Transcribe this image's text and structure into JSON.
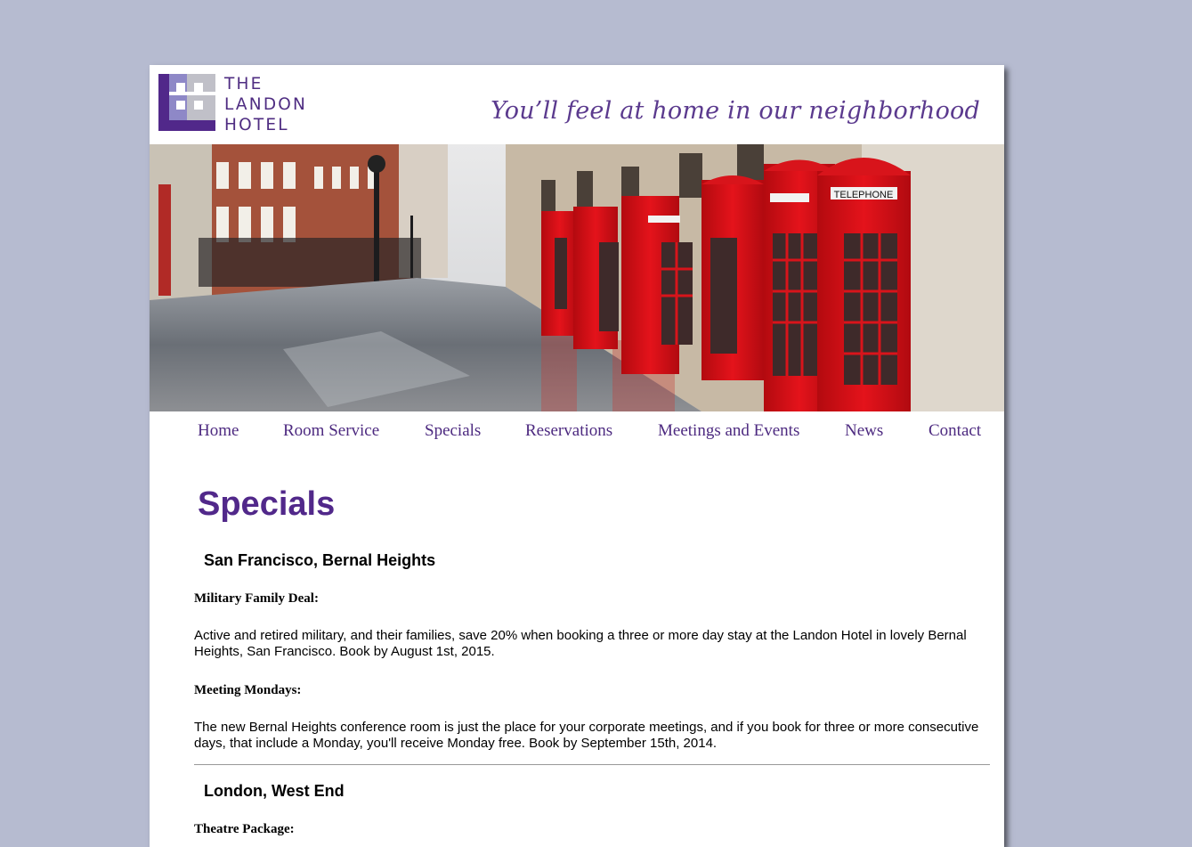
{
  "brand": {
    "logo_lines": [
      "THE",
      "LANDON",
      "HOTEL"
    ],
    "tagline": "You’ll feel at home in our neighborhood",
    "colors": {
      "brand_purple": "#4f2d82",
      "logo_lavender": "#8e88c7",
      "logo_gray": "#c0c0c8"
    }
  },
  "hero": {
    "subject": "London street with red telephone boxes",
    "booth_sign": "TELEPHONE"
  },
  "nav": {
    "items": [
      "Home",
      "Room Service",
      "Specials",
      "Reservations",
      "Meetings and Events",
      "News",
      "Contact"
    ]
  },
  "main": {
    "title": "Specials",
    "sections": [
      {
        "heading": "San Francisco, Bernal Heights",
        "deals": [
          {
            "title": "Military Family Deal:",
            "text": "Active and retired military, and their families, save 20% when booking a three or more day stay at the Landon Hotel in lovely Bernal Heights, San Francisco. Book by August 1st, 2015."
          },
          {
            "title": "Meeting Mondays:",
            "text": "The new Bernal Heights conference room is just the place for your corporate meetings, and if you book for three or more consecutive days, that include a Monday, you'll receive Monday free. Book by September 15th, 2014."
          }
        ]
      },
      {
        "heading": "London, West End",
        "deals": [
          {
            "title": "Theatre Package:"
          }
        ]
      }
    ]
  }
}
